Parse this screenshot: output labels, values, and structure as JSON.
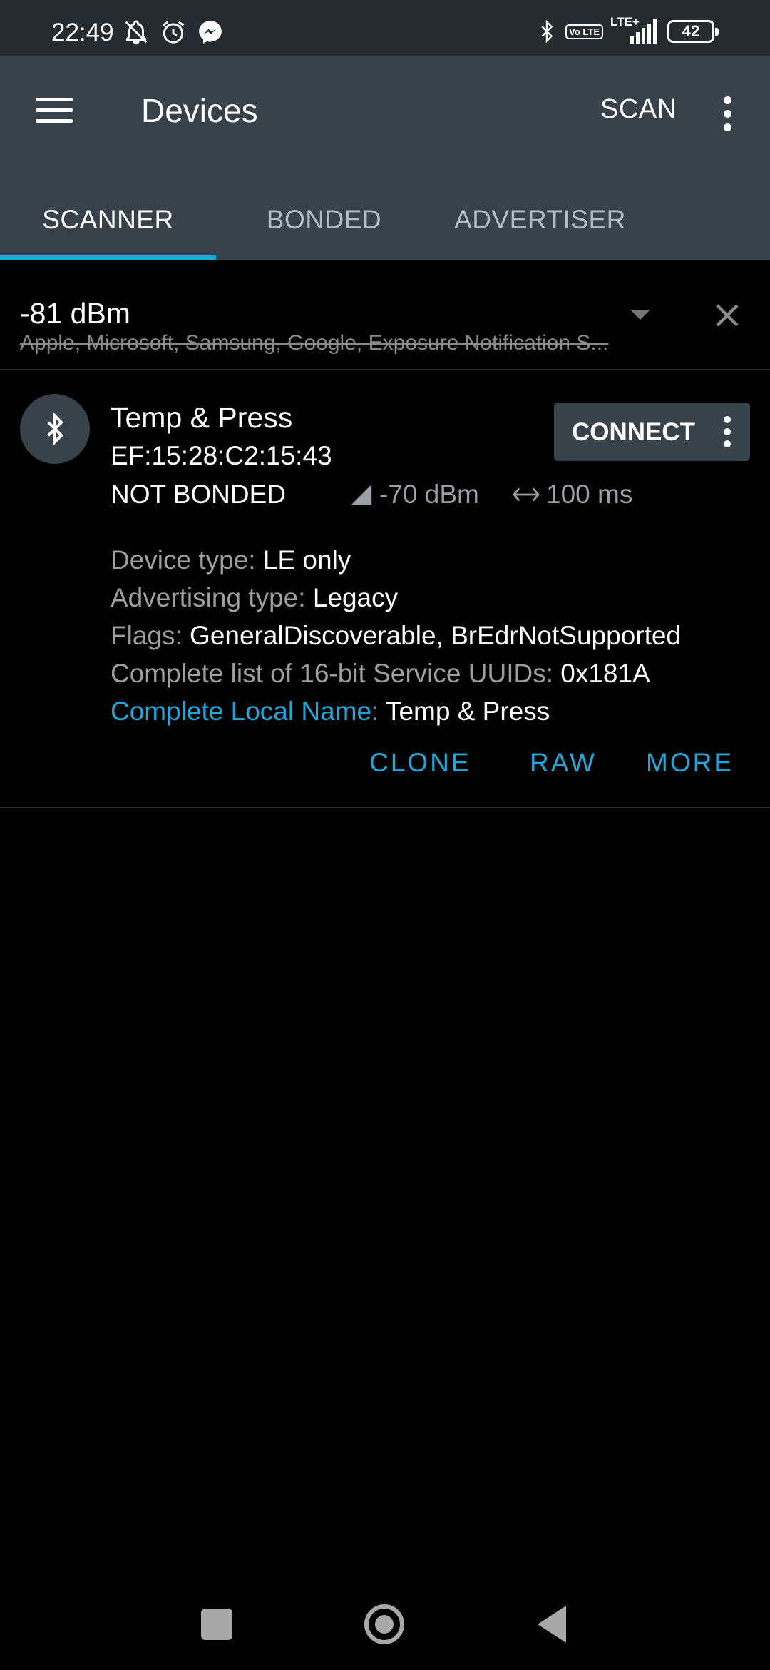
{
  "status_bar": {
    "time": "22:49",
    "battery": "42",
    "network": "LTE+",
    "volte": "Vo LTE",
    "icons": [
      "bell-off-icon",
      "alarm-icon",
      "messenger-icon",
      "bluetooth-icon",
      "volte-icon",
      "signal-icon",
      "battery-icon"
    ]
  },
  "app_bar": {
    "title": "Devices",
    "scan_label": "SCAN",
    "icons": [
      "menu-icon",
      "overflow-icon"
    ]
  },
  "tabs": [
    {
      "label": "SCANNER",
      "active": true
    },
    {
      "label": "BONDED",
      "active": false
    },
    {
      "label": "ADVERTISER",
      "active": false
    }
  ],
  "colors": {
    "accent": "#1ea7dc",
    "app_bar": "#37424b",
    "status_bar": "#262b30",
    "background": "#000000",
    "secondary_text": "#9e9e9e"
  },
  "filter": {
    "rssi": "-81 dBm",
    "excluded": "Apple, Microsoft, Samsung, Google, Exposure Notification S..."
  },
  "device": {
    "name": "Temp & Press",
    "mac": "EF:15:28:C2:15:43",
    "bond_state": "NOT BONDED",
    "rssi": "-70 dBm",
    "interval": "100 ms",
    "connect_label": "CONNECT",
    "details": [
      {
        "key": "Device type: ",
        "value": "LE only",
        "highlight": false
      },
      {
        "key": "Advertising type: ",
        "value": "Legacy",
        "highlight": false
      },
      {
        "key": "Flags: ",
        "value": "GeneralDiscoverable, BrEdrNotSupported",
        "highlight": false
      },
      {
        "key": "Complete list of 16-bit Service UUIDs: ",
        "value": "0x181A",
        "highlight": false
      },
      {
        "key": "Complete Local Name: ",
        "value": "Temp & Press",
        "highlight": true
      }
    ],
    "actions": {
      "clone": "CLONE",
      "raw": "RAW",
      "more": "MORE"
    }
  }
}
